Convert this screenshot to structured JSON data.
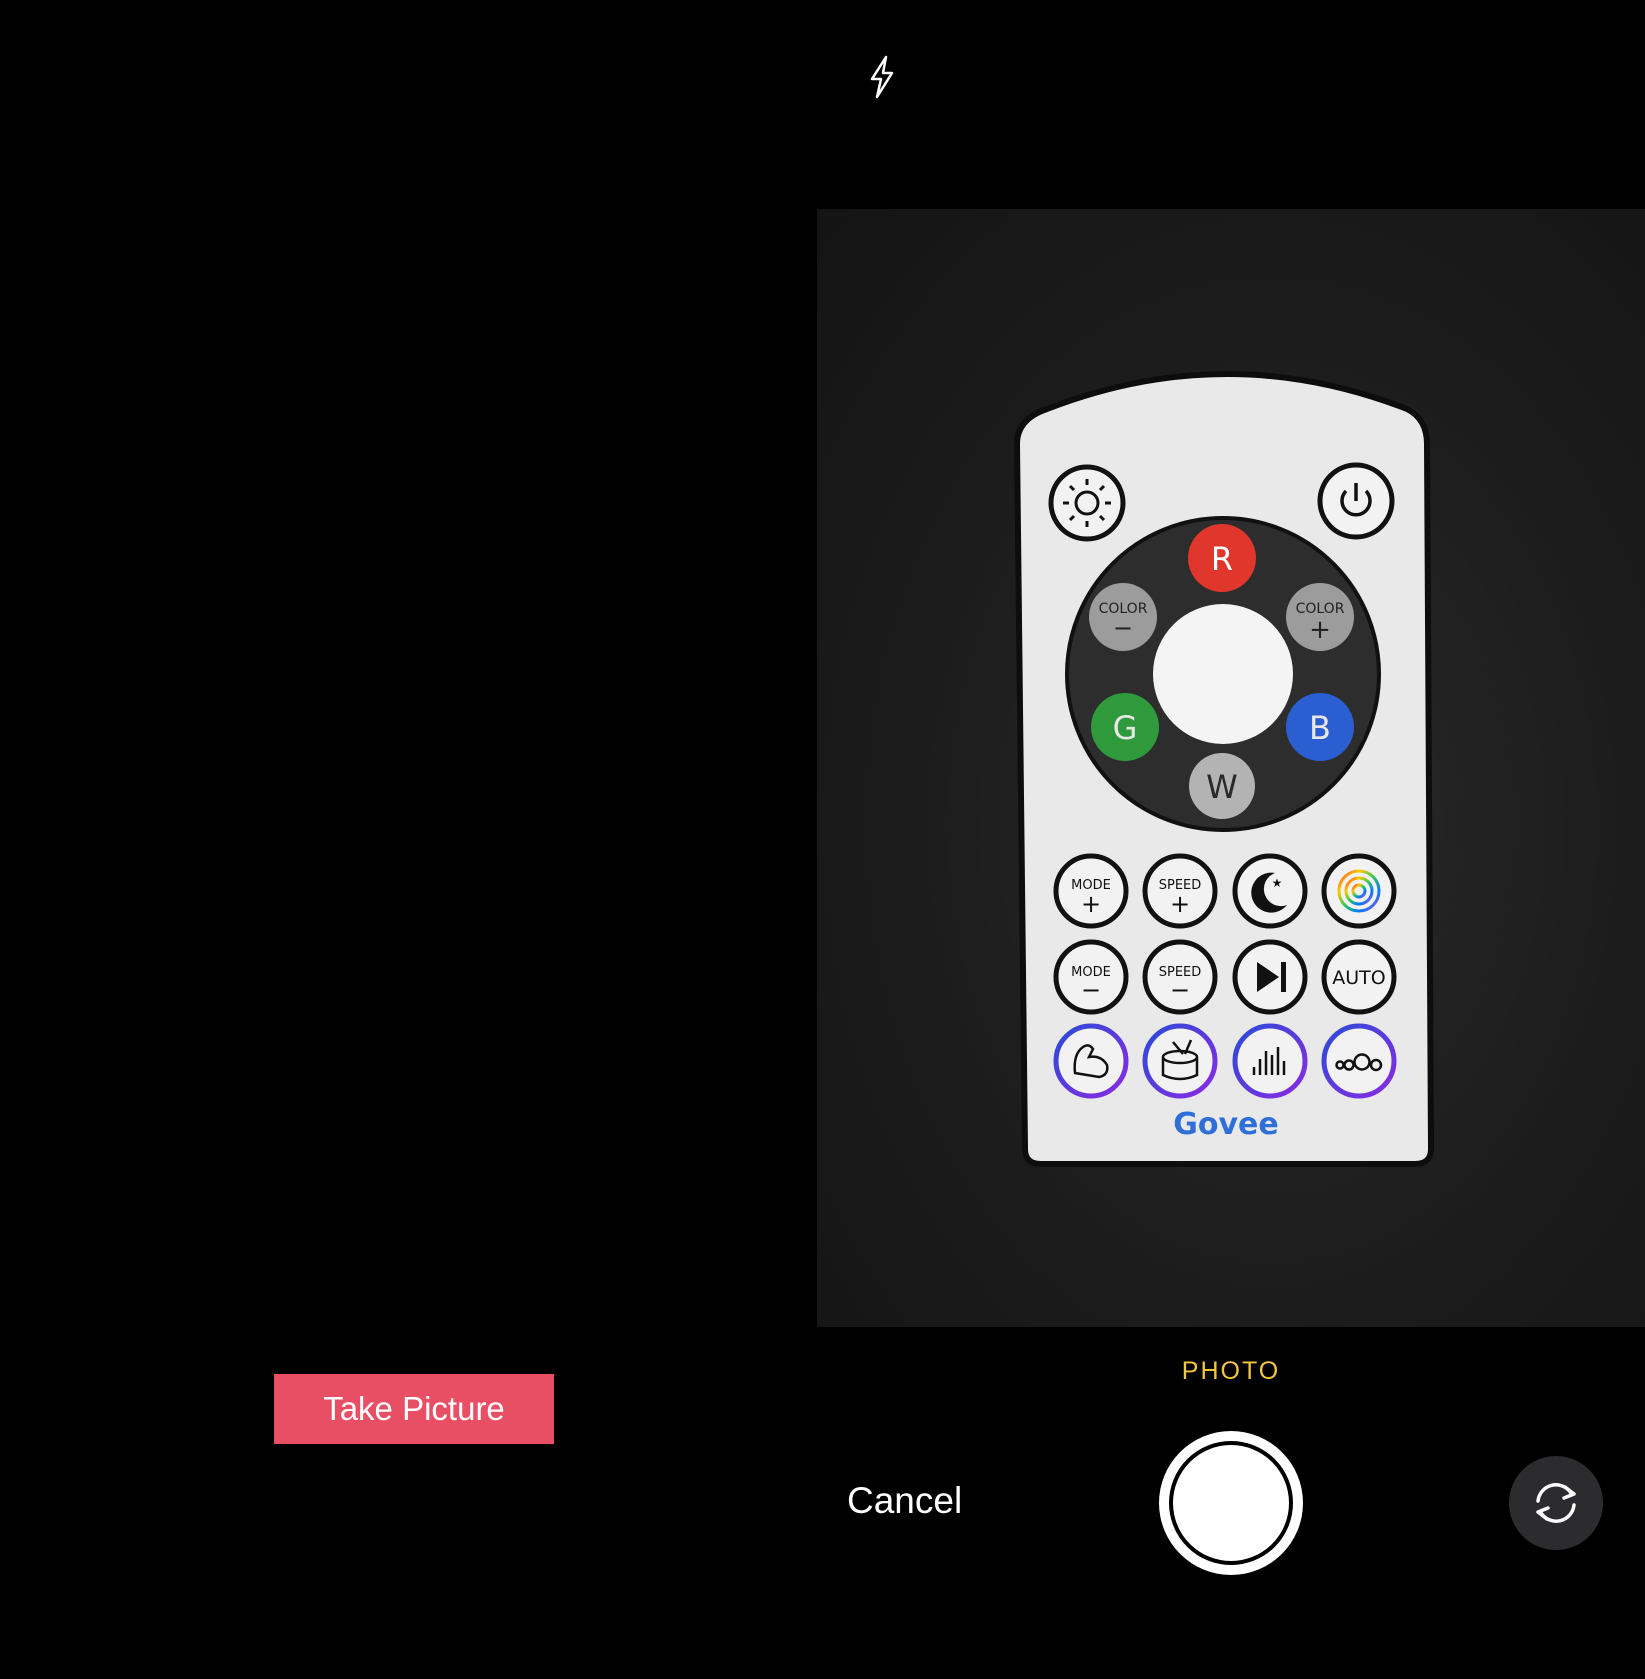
{
  "left_pane": {
    "take_picture_label": "Take Picture",
    "button_color": "#e94f64"
  },
  "camera": {
    "flash_icon": "flash-icon",
    "mode_label": "PHOTO",
    "cancel_label": "Cancel",
    "shutter_icon": "shutter-button",
    "flip_icon": "camera-flip-icon",
    "mode_color": "#f3c63f"
  },
  "remote": {
    "brand": "Govee",
    "ring_buttons": {
      "r": "R",
      "g": "G",
      "b": "B",
      "w": "W",
      "color_minus_top": "COLOR",
      "color_minus_sign": "−",
      "color_plus_top": "COLOR",
      "color_plus_sign": "+"
    },
    "grid": {
      "mode_plus_top": "MODE",
      "mode_plus_sign": "+",
      "speed_plus_top": "SPEED",
      "speed_plus_sign": "+",
      "mode_minus_top": "MODE",
      "mode_minus_sign": "−",
      "speed_minus_top": "SPEED",
      "speed_minus_sign": "−",
      "auto": "AUTO"
    },
    "icons": [
      "brightness-icon",
      "power-icon",
      "night-moon-icon",
      "rainbow-swirl-icon",
      "play-next-icon",
      "muscle-icon",
      "drum-icon",
      "equalizer-icon",
      "bubbles-icon"
    ]
  }
}
